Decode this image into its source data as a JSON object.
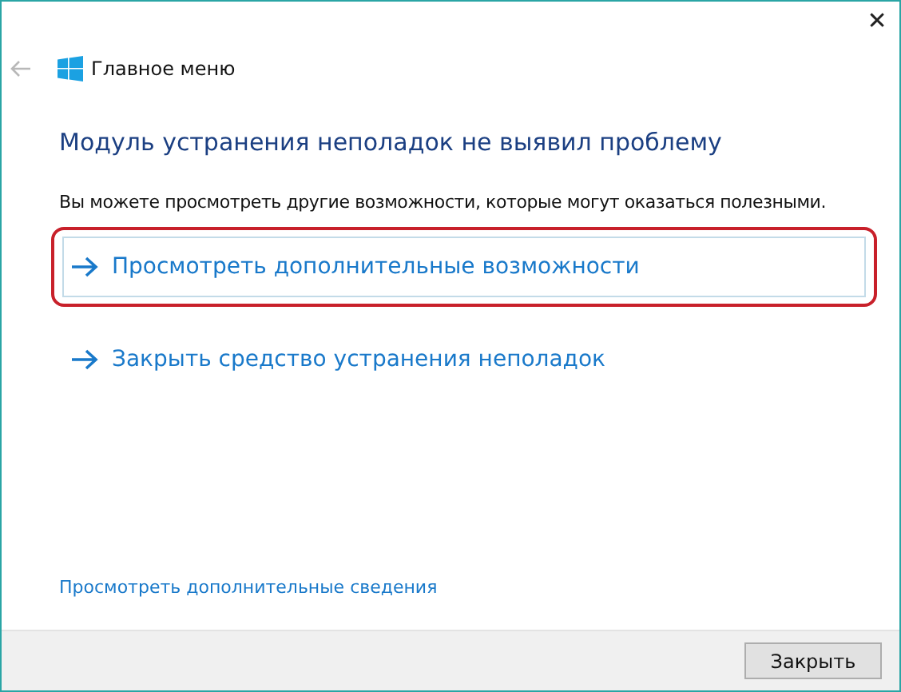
{
  "window": {
    "close_label": "✕"
  },
  "header": {
    "title": "Главное меню",
    "back_disabled": true
  },
  "heading": "Модуль устранения неполадок не выявил проблему",
  "description": "Вы можете просмотреть другие возможности, которые могут оказаться полезными.",
  "options": [
    {
      "label": "Просмотреть дополнительные возможности",
      "selected": true,
      "circled": true
    },
    {
      "label": "Закрыть средство устранения неполадок",
      "selected": false,
      "circled": false
    }
  ],
  "details_link": "Просмотреть дополнительные сведения",
  "footer": {
    "buttons": [
      "Закрыть"
    ]
  }
}
